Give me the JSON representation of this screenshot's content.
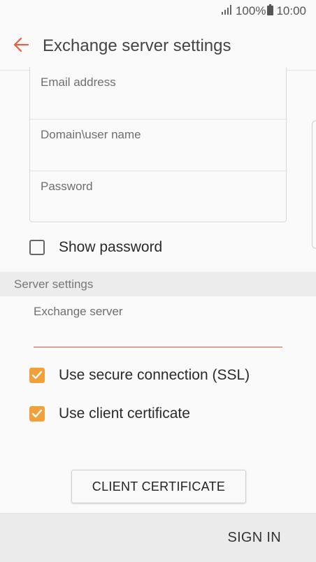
{
  "status_bar": {
    "signal_icon": "signal-bars-icon",
    "battery_percent": "100%",
    "battery_icon": "battery-icon",
    "time": "10:00"
  },
  "app_bar": {
    "back_icon": "arrow-left-icon",
    "title": "Exchange server settings",
    "accent_color": "#e4603e"
  },
  "account": {
    "email_placeholder": "Email address",
    "domain_user_placeholder": "Domain\\user name",
    "password_placeholder": "Password"
  },
  "show_password": {
    "label": "Show password",
    "checked": false
  },
  "server_settings": {
    "section_title": "Server settings",
    "exchange_server_label": "Exchange server",
    "exchange_server_value": ""
  },
  "options": {
    "secure_connection": {
      "label": "Use secure connection (SSL)",
      "checked": true
    },
    "client_certificate": {
      "label": "Use client certificate",
      "checked": true
    },
    "checkbox_color": "#f4a03a"
  },
  "buttons": {
    "client_certificate": "CLIENT CERTIFICATE",
    "sign_in": "SIGN IN"
  }
}
